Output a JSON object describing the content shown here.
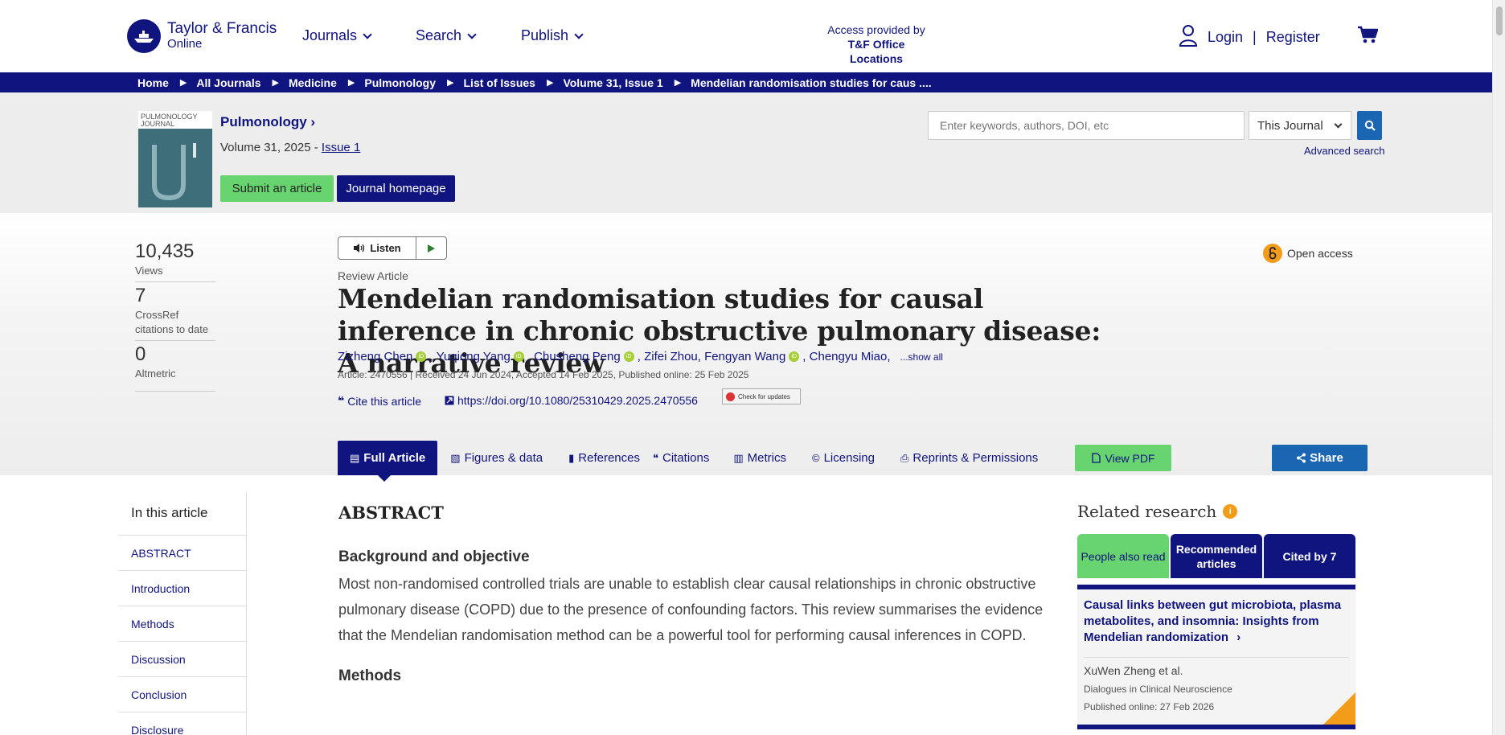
{
  "header": {
    "logo_line1": "Taylor & Francis",
    "logo_line2": "Online",
    "nav": [
      {
        "label": "Journals"
      },
      {
        "label": "Search"
      },
      {
        "label": "Publish"
      }
    ],
    "access_line1": "Access provided by",
    "access_line2": "T&F Office Locations",
    "login": "Login",
    "separator": "|",
    "register": "Register"
  },
  "breadcrumb": [
    "Home",
    "All Journals",
    "Medicine",
    "Pulmonology",
    "List of Issues",
    "Volume 31, Issue 1",
    "Mendelian randomisation studies for caus ...."
  ],
  "breadcrumb_arrow": "▶",
  "journal": {
    "cover_text": "PULMONOLOGY JOURNAL",
    "title": "Pulmonology ›",
    "volume_prefix": "Volume 31, 2025 - ",
    "issue": "Issue 1",
    "submit_label": "Submit an article",
    "homepage_label": "Journal homepage"
  },
  "search": {
    "placeholder": "Enter keywords, authors, DOI, etc",
    "scope": "This Journal",
    "advanced": "Advanced search"
  },
  "metrics": [
    {
      "value": "10,435",
      "label": "Views"
    },
    {
      "value": "7",
      "label": "CrossRef citations to date"
    },
    {
      "value": "0",
      "label": "Altmetric"
    }
  ],
  "article": {
    "listen_label": "Listen",
    "type": "Review Article",
    "title": "Mendelian randomisation studies for causal inference in chronic obstructive pulmonary disease: A narrative review",
    "authors": [
      "Zizheng Chen",
      "Yuqiong Yang",
      "Chusheng Peng",
      "Zifei Zhou",
      "Fengyan Wang",
      "Chengyu Miao"
    ],
    "show_all": "...show all",
    "info": "Article: 2470556 | Received 24 Jun 2024, Accepted 14 Feb 2025, Published online: 25 Feb 2025",
    "cite_label": "Cite this article",
    "doi": "https://doi.org/10.1080/25310429.2025.2470556",
    "check_updates": "Check for updates",
    "open_access": "Open access"
  },
  "tabs": [
    {
      "label": "Full Article",
      "icon": "▤"
    },
    {
      "label": "Figures & data",
      "icon": "▧"
    },
    {
      "label": "References",
      "icon": "▮"
    },
    {
      "label": "Citations",
      "icon": "❝"
    },
    {
      "label": "Metrics",
      "icon": "▥"
    },
    {
      "label": "Licensing",
      "icon": "©"
    },
    {
      "label": "Reprints & Permissions",
      "icon": "⎙"
    }
  ],
  "view_pdf": "View PDF",
  "share": "Share",
  "toc": {
    "heading": "In this article",
    "items": [
      "ABSTRACT",
      "Introduction",
      "Methods",
      "Discussion",
      "Conclusion",
      "Disclosure"
    ]
  },
  "abstract": {
    "heading": "ABSTRACT",
    "sub1": "Background and objective",
    "para1": "Most non-randomised controlled trials are unable to establish clear causal relationships in chronic obstructive pulmonary disease (COPD) due to the presence of confounding factors. This review summarises the evidence that the Mendelian randomisation method can be a powerful tool for performing causal inferences in COPD.",
    "sub2": "Methods"
  },
  "related": {
    "heading": "Related research",
    "info_icon": "i",
    "tabs": [
      "People also read",
      "Recommended articles",
      "Cited by 7"
    ],
    "card": {
      "title": "Causal links between gut microbiota, plasma metabolites, and insomnia: Insights from Mendelian randomization",
      "arrow": "›",
      "authors": "XuWen Zheng et al.",
      "journal": "Dialogues in Clinical Neuroscience",
      "published": "Published online: 27 Feb 2026"
    }
  },
  "colors": {
    "navy": "#10147e",
    "green": "#68d46f",
    "blue": "#1a66b3",
    "orange": "#f39c1a",
    "orcid": "#a6ce39"
  }
}
